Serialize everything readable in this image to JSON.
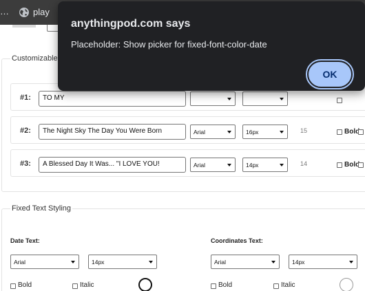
{
  "browser": {
    "tab_ellipsis": "…",
    "tab_title": "play"
  },
  "customizable": {
    "legend": "Customizable",
    "rows": [
      {
        "num": "#1:",
        "text": "TO MY",
        "font": "",
        "size": "",
        "count": ""
      },
      {
        "num": "#2:",
        "text": "The Night Sky The Day You Were Born",
        "font": "Arial",
        "size": "16px",
        "count": "15",
        "bold_label": "Bold"
      },
      {
        "num": "#3:",
        "text": "A Blessed Day It Was... \"I LOVE YOU!",
        "font": "Arial",
        "size": "14px",
        "count": "14",
        "bold_label": "Bold"
      }
    ]
  },
  "fixed": {
    "legend": "Fixed Text Styling",
    "date": {
      "label": "Date Text:",
      "font": "Arial",
      "size": "14px",
      "bold_label": "Bold",
      "italic_label": "Italic",
      "color": "#000000"
    },
    "coords": {
      "label": "Coordinates Text:",
      "font": "Arial",
      "size": "14px",
      "bold_label": "Bold",
      "italic_label": "Italic",
      "color": "#ffffff"
    }
  },
  "dialog": {
    "title": "anythingpod.com says",
    "message": "Placeholder: Show picker for fixed-font-color-date",
    "ok_label": "OK"
  },
  "colors": {
    "dialog_bg": "#202124",
    "accent": "#a8c7fa",
    "tabbar": "#3c3c3c"
  }
}
